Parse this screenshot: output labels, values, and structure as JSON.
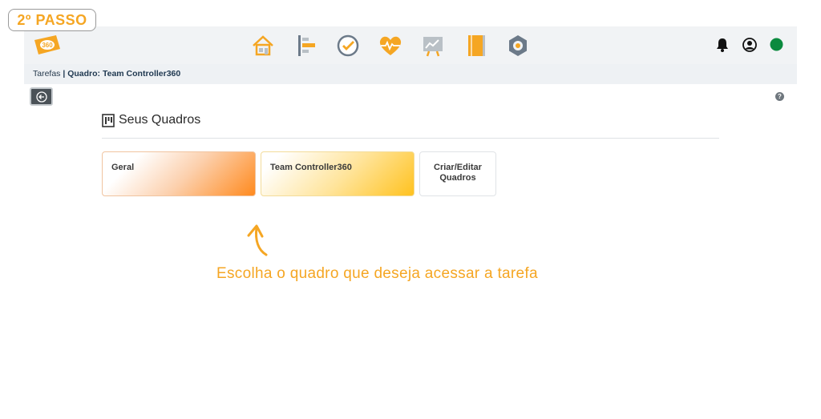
{
  "badge": {
    "text": "2º PASSO"
  },
  "header": {
    "logo_icon": "controller360-logo",
    "logo_text": "360",
    "nav": [
      {
        "name": "home-icon",
        "color": "#f5a623"
      },
      {
        "name": "timeline-icon",
        "color": "#f5a623"
      },
      {
        "name": "clock-check-icon",
        "color": "#f5a623"
      },
      {
        "name": "heart-pulse-icon",
        "color": "#f5a623"
      },
      {
        "name": "chart-board-icon",
        "color": "#f5a623"
      },
      {
        "name": "notebook-icon",
        "color": "#f5a623"
      },
      {
        "name": "settings-gear-icon",
        "color": "#6c7a89"
      }
    ],
    "right": {
      "bell_icon": "bell-icon",
      "user_icon": "user-circle-icon",
      "status_color": "#0b8a3e"
    }
  },
  "breadcrumb": {
    "root": "Tarefas",
    "separator": " | ",
    "current": "Quadro: Team Controller360"
  },
  "section": {
    "title": "Seus Quadros"
  },
  "boards": [
    {
      "label": "Geral"
    },
    {
      "label": "Team Controller360"
    }
  ],
  "edit_boards": {
    "label": "Criar/Editar Quadros"
  },
  "hint": {
    "text": "Escolha o quadro que deseja acessar a tarefa"
  },
  "colors": {
    "accent": "#f5a623",
    "orange": "#ff8a1e",
    "yellow": "#ffc21f",
    "online": "#0b8a3e"
  }
}
